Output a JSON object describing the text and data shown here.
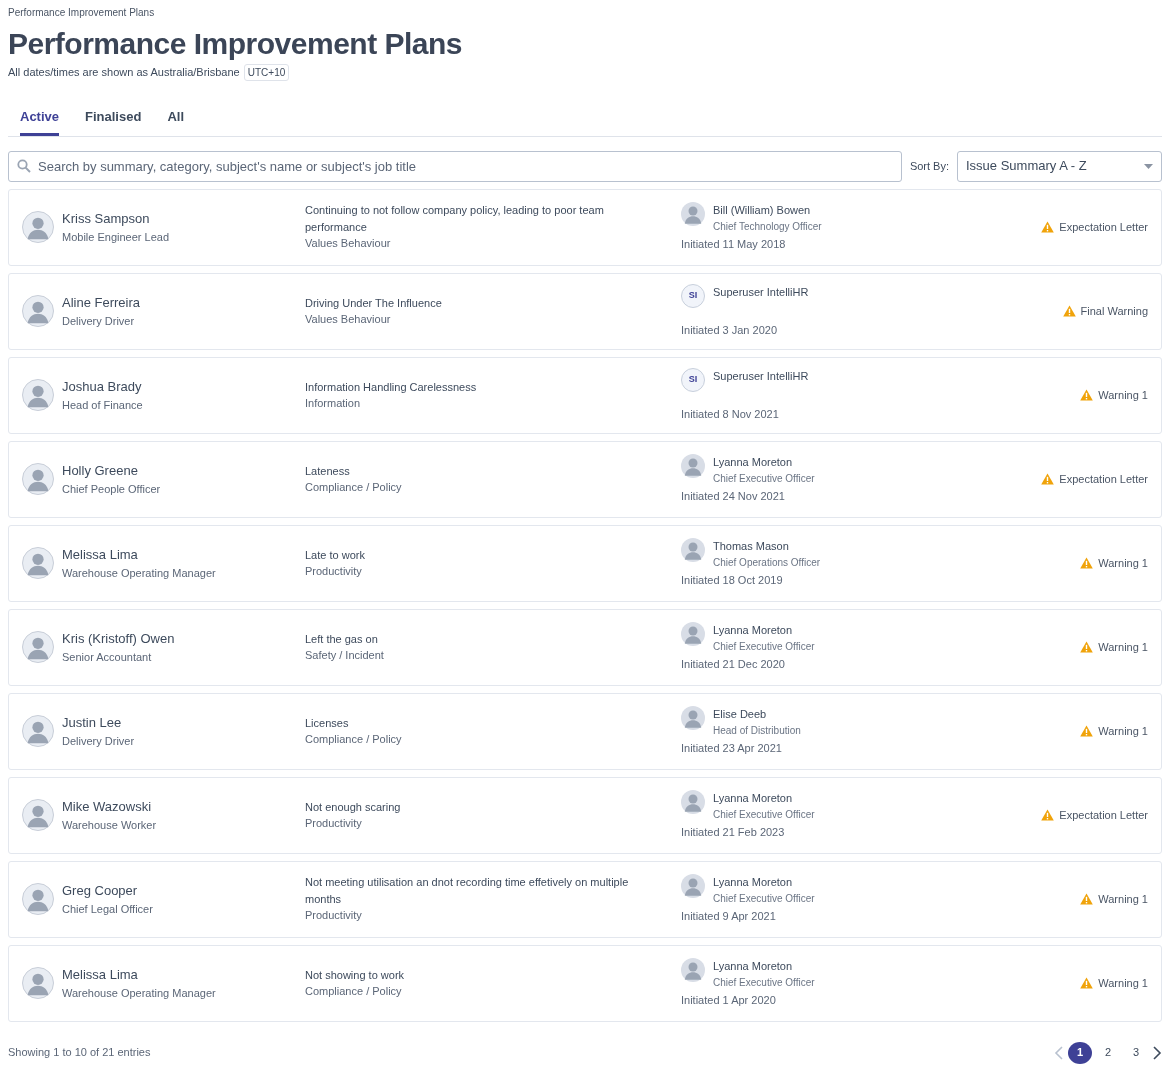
{
  "breadcrumb": "Performance Improvement Plans",
  "title": "Performance Improvement Plans",
  "timezone_note": "All dates/times are shown as Australia/Brisbane",
  "timezone_badge": "UTC+10",
  "tabs": [
    {
      "label": "Active",
      "selected": true
    },
    {
      "label": "Finalised",
      "selected": false
    },
    {
      "label": "All",
      "selected": false
    }
  ],
  "search": {
    "placeholder": "Search by summary, category, subject's name or subject's job title"
  },
  "sort": {
    "label": "Sort By:",
    "value": "Issue Summary A - Z"
  },
  "plans": [
    {
      "subject": "Kriss Sampson",
      "job": "Mobile Engineer Lead",
      "summary": "Continuing to not follow company policy, leading to poor team performance",
      "category": "Values Behaviour",
      "initiator": {
        "kind": "photo",
        "name": "Bill (William) Bowen",
        "job": "Chief Technology Officer"
      },
      "initiated": "Initiated 11 May 2018",
      "outcome": "Expectation Letter"
    },
    {
      "subject": "Aline Ferreira",
      "job": "Delivery Driver",
      "summary": "Driving Under The Influence",
      "category": "Values Behaviour",
      "initiator": {
        "kind": "initials",
        "initials": "SI",
        "name": "Superuser IntelliHR"
      },
      "initiated": "Initiated 3 Jan 2020",
      "outcome": "Final Warning"
    },
    {
      "subject": "Joshua Brady",
      "job": "Head of Finance",
      "summary": "Information Handling Carelessness",
      "category": "Information",
      "initiator": {
        "kind": "initials",
        "initials": "SI",
        "name": "Superuser IntelliHR"
      },
      "initiated": "Initiated 8 Nov 2021",
      "outcome": "Warning 1"
    },
    {
      "subject": "Holly Greene",
      "job": "Chief People Officer",
      "summary": "Lateness",
      "category": "Compliance / Policy",
      "initiator": {
        "kind": "photo",
        "name": "Lyanna Moreton",
        "job": "Chief Executive Officer"
      },
      "initiated": "Initiated 24 Nov 2021",
      "outcome": "Expectation Letter"
    },
    {
      "subject": "Melissa Lima",
      "job": "Warehouse Operating Manager",
      "summary": "Late to work",
      "category": "Productivity",
      "initiator": {
        "kind": "photo",
        "name": "Thomas Mason",
        "job": "Chief Operations Officer"
      },
      "initiated": "Initiated 18 Oct 2019",
      "outcome": "Warning 1"
    },
    {
      "subject": "Kris (Kristoff) Owen",
      "job": "Senior Accountant",
      "summary": "Left the gas on",
      "category": "Safety / Incident",
      "initiator": {
        "kind": "photo",
        "name": "Lyanna Moreton",
        "job": "Chief Executive Officer"
      },
      "initiated": "Initiated 21 Dec 2020",
      "outcome": "Warning 1"
    },
    {
      "subject": "Justin Lee",
      "job": "Delivery Driver",
      "summary": "Licenses",
      "category": "Compliance / Policy",
      "initiator": {
        "kind": "photo",
        "name": "Elise Deeb",
        "job": "Head of Distribution"
      },
      "initiated": "Initiated 23 Apr 2021",
      "outcome": "Warning 1"
    },
    {
      "subject": "Mike Wazowski",
      "job": "Warehouse Worker",
      "summary": "Not enough scaring",
      "category": "Productivity",
      "initiator": {
        "kind": "photo",
        "name": "Lyanna Moreton",
        "job": "Chief Executive Officer"
      },
      "initiated": "Initiated 21 Feb 2023",
      "outcome": "Expectation Letter"
    },
    {
      "subject": "Greg Cooper",
      "job": "Chief Legal Officer",
      "summary": "Not meeting utilisation an dnot recording time effetively on multiple months",
      "category": "Productivity",
      "initiator": {
        "kind": "photo",
        "name": "Lyanna Moreton",
        "job": "Chief Executive Officer"
      },
      "initiated": "Initiated 9 Apr 2021",
      "outcome": "Warning 1"
    },
    {
      "subject": "Melissa Lima",
      "job": "Warehouse Operating Manager",
      "summary": "Not showing to work",
      "category": "Compliance / Policy",
      "initiator": {
        "kind": "photo",
        "name": "Lyanna Moreton",
        "job": "Chief Executive Officer"
      },
      "initiated": "Initiated 1 Apr 2020",
      "outcome": "Warning 1"
    }
  ],
  "footer": {
    "summary": "Showing 1 to 10 of 21 entries",
    "previous_disabled": true,
    "next_disabled": false,
    "pages": [
      {
        "label": "1",
        "selected": true
      },
      {
        "label": "2",
        "selected": false
      },
      {
        "label": "3",
        "selected": false
      }
    ]
  }
}
